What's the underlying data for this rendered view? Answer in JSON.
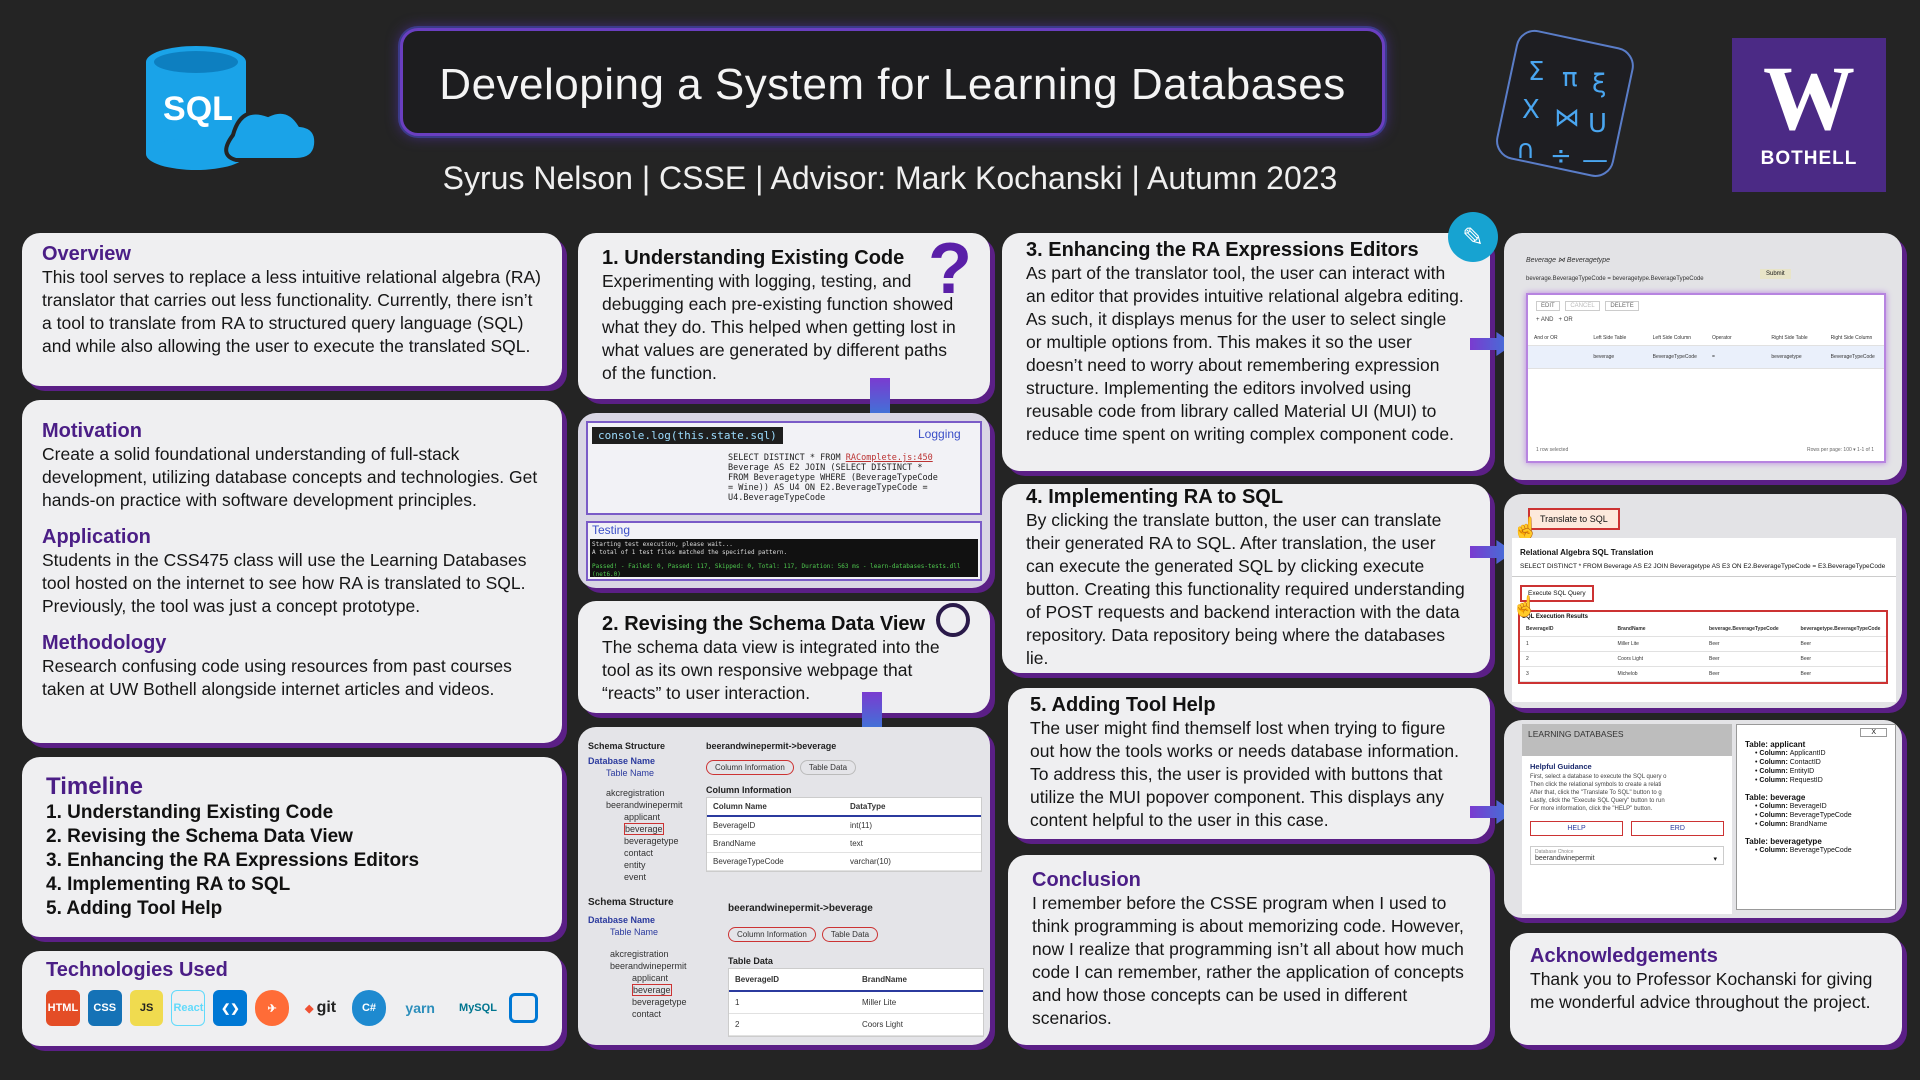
{
  "header": {
    "title": "Developing a System for Learning Databases",
    "subtitle": "Syrus Nelson | CSSE | Advisor: Mark Kochanski | Autumn 2023",
    "uw_logo_letter": "W",
    "uw_logo_text": "BOTHELL",
    "sql_logo_text": "SQL",
    "math_symbols": [
      "Σ",
      "π",
      "ξ",
      "X",
      "⋈",
      "U",
      "∩",
      "÷",
      "—"
    ]
  },
  "left": {
    "overview": {
      "heading": "Overview",
      "body": "This tool serves to replace a less intuitive relational algebra (RA) translator that carries out less functionality. Currently, there isn’t a tool to translate from RA to structured query language (SQL) and while also allowing the user to execute the translated SQL."
    },
    "motivation": {
      "heading": "Motivation",
      "body": "Create a solid foundational understanding of full-stack development, utilizing database concepts and technologies. Get hands-on practice with software development principles."
    },
    "application": {
      "heading": "Application",
      "body": "Students in the CSS475 class will use the Learning Databases tool hosted on the internet to see how RA is translated to SQL. Previously, the tool was just a concept prototype."
    },
    "methodology": {
      "heading": "Methodology",
      "body": "Research confusing code using resources from past courses taken at UW Bothell alongside internet articles and videos."
    },
    "timeline": {
      "heading": "Timeline",
      "items": [
        "1. Understanding Existing Code",
        "2. Revising the Schema Data View",
        "3. Enhancing the RA Expressions Editors",
        "4. Implementing RA to SQL",
        "5. Adding Tool Help"
      ]
    },
    "technologies": {
      "heading": "Technologies Used",
      "icons": [
        "html5-icon",
        "css3-icon",
        "js-icon",
        "react-icon",
        "vscode-icon",
        "postman-icon",
        "git-icon",
        "csharp-icon",
        "yarn-icon",
        "mysql-icon",
        "azure-icon"
      ],
      "labels": {
        "html": "HTML",
        "css": "CSS",
        "js": "JS",
        "react": "React",
        "git": "git",
        "csharp": "C#",
        "yarn": "yarn",
        "mysql": "MySQL"
      }
    }
  },
  "middle": {
    "section1": {
      "heading": "1. Understanding Existing Code",
      "body": "Experimenting with logging, testing, and debugging each pre-existing function showed what they do. This helped when getting lost in what values are generated by different paths of the function."
    },
    "logging_shot": {
      "console_code": "console.log(this.state.sql)",
      "label_logging": "Logging",
      "sql_line1": "SELECT DISTINCT * FROM",
      "sql_link": "RAComplete.js:450",
      "sql_rest": "Beverage AS E2 JOIN (SELECT DISTINCT * FROM Beveragetype WHERE (BeverageTypeCode = Wine)) AS U4 ON E2.BeverageTypeCode = U4.BeverageTypeCode",
      "label_testing": "Testing",
      "test_line1": "Starting test execution, please wait...",
      "test_line2": "A total of 1 test files matched the specified pattern.",
      "test_line3": "Passed! - Failed: 0, Passed: 117, Skipped: 0, Total: 117, Duration: 563 ms - learn-databases-tests.dll (net6.0)"
    },
    "section2": {
      "heading": "2. Revising the Schema Data View",
      "body": "The schema data view is integrated into the tool as its own responsive webpage that “reacts” to user interaction."
    },
    "schema_shot": {
      "schema_structure": "Schema Structure",
      "database_name": "Database Name",
      "table_name": "Table Name",
      "path": "beerandwinepermit->beverage",
      "tab_column_info": "Column Information",
      "tab_table_data": "Table Data",
      "column_info_heading": "Column Information",
      "col_header": [
        "Column Name",
        "DataType"
      ],
      "col_rows": [
        [
          "BeverageID",
          "int(11)"
        ],
        [
          "BrandName",
          "text"
        ],
        [
          "BeverageTypeCode",
          "varchar(10)"
        ]
      ],
      "tree": [
        "akcregistration",
        "beerandwinepermit",
        "applicant",
        "beverage",
        "beveragetype",
        "contact",
        "entity",
        "event"
      ],
      "table_data_heading": "Table Data",
      "data_header": [
        "BeverageID",
        "BrandName"
      ],
      "data_rows": [
        [
          "1",
          "Miller Lite"
        ],
        [
          "2",
          "Coors Light"
        ]
      ]
    }
  },
  "right": {
    "section3": {
      "heading": "3. Enhancing the RA Expressions Editors",
      "body": "As part of the translator tool, the user can interact with an editor that provides intuitive relational algebra editing. As such, it displays menus for the user to select single or multiple options from. This makes it so the user doesn’t need to worry about remembering expression structure. Implementing the editors involved using reusable code from library called Material UI (MUI) to reduce time spent on writing complex component code."
    },
    "section4": {
      "heading": "4. Implementing RA to SQL",
      "body": "By clicking the translate button, the user can translate their generated RA to SQL. After translation, the user can execute the generated SQL by clicking  execute button. Creating this functionality required understanding of POST requests and backend interaction with the data repository. Data repository being where the databases lie."
    },
    "section5": {
      "heading": "5. Adding Tool Help",
      "body": "The user might find themself lost when trying to figure out how the tools works or needs database information. To address this,  the user is provided with buttons that utilize the MUI popover component. This displays any content helpful to the user in this case."
    },
    "conclusion": {
      "heading": "Conclusion",
      "body": "I remember before the CSSE program when I used to think programming is about memorizing code. However, now I realize that programming isn’t all about how much code I can remember, rather the application of concepts and how those concepts can be used in different scenarios."
    },
    "editor_shot": {
      "expr": "Beverage ⋈ Beveragetype",
      "cond": "beverage.BeverageTypeCode = beveragetype.BeverageTypeCode",
      "submit": "Submit",
      "btn_edit": "EDIT",
      "btn_cancel": "CANCEL",
      "btn_delete": "DELETE",
      "and": "AND",
      "or": "OR",
      "headers": [
        "And or OR",
        "Left Side Table",
        "Left Side Column",
        "Operator",
        "Right Side Table",
        "Right Side Column"
      ],
      "row": [
        "",
        "beverage",
        "BeverageTypeCode",
        "=",
        "beveragetype",
        "BeverageTypeCode"
      ],
      "footer_left": "1 row selected",
      "footer_right": "Rows per page: 100 ▾    1-1 of 1"
    },
    "translate_shot": {
      "translate_btn": "Translate to SQL",
      "heading": "Relational Algebra SQL Translation",
      "sql": "SELECT DISTINCT * FROM Beverage AS E2 JOIN Beveragetype AS E3 ON E2.BeverageTypeCode = E3.BeverageTypeCode",
      "execute_btn": "Execute SQL Query",
      "results_heading": "SQL Execution Results",
      "res_header": [
        "BeverageID",
        "BrandName",
        "beverage.BeverageTypeCode",
        "beveragetype.BeverageTypeCode"
      ],
      "res_rows": [
        [
          "1",
          "Miller Lite",
          "Beer",
          "Beer"
        ],
        [
          "2",
          "Coors Light",
          "Beer",
          "Beer"
        ],
        [
          "3",
          "Michelob",
          "Beer",
          "Beer"
        ]
      ]
    },
    "help_shot": {
      "header": "LEARNING DATABASES",
      "close": "X",
      "guidance_heading": "Helpful Guidance",
      "guidance_lines": [
        "First, select a database to execute the SQL query o",
        "Then click the relational symbols to create a relati",
        "After that, click the \"Translate To SQL\" button to g",
        "Lastly, click the \"Execute SQL Query\" button to run",
        "For more information, click the \"HELP\" button."
      ],
      "help_btn": "HELP",
      "erd_btn": "ERD",
      "db_choice_label": "Database Choice",
      "db_choice_value": "beerandwinepermit",
      "tables": [
        {
          "title": "Table: applicant",
          "cols": [
            "ApplicantID",
            "ContactID",
            "EntityID",
            "RequestID"
          ]
        },
        {
          "title": "Table: beverage",
          "cols": [
            "BeverageID",
            "BeverageTypeCode",
            "BrandName"
          ]
        },
        {
          "title": "Table: beveragetype",
          "cols": [
            "BeverageTypeCode"
          ]
        }
      ],
      "column_prefix": "Column: "
    },
    "acknowledgements": {
      "heading": "Acknowledgements",
      "body": "Thank you to Professor Kochanski for giving me wonderful advice throughout the project."
    }
  }
}
